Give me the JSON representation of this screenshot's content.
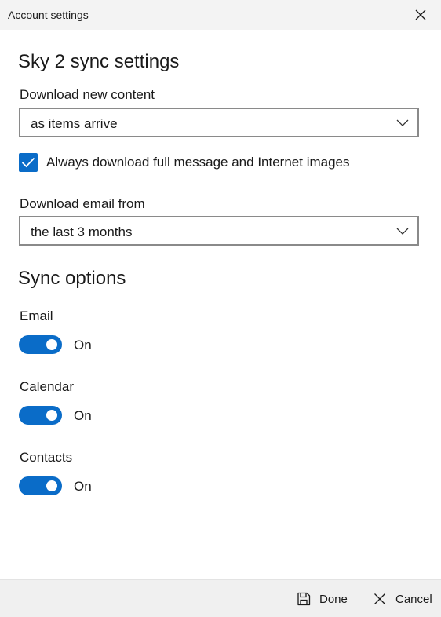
{
  "window": {
    "title": "Account settings",
    "close_icon": "close-icon"
  },
  "sync_settings": {
    "heading": "Sky 2 sync settings",
    "download_new_content": {
      "label": "Download new content",
      "value": "as items arrive"
    },
    "full_message_checkbox": {
      "label": "Always download full message and Internet images",
      "checked": true
    },
    "download_email_from": {
      "label": "Download email from",
      "value": "the last 3 months"
    }
  },
  "sync_options": {
    "heading": "Sync options",
    "items": [
      {
        "label": "Email",
        "state": "On",
        "on": true
      },
      {
        "label": "Calendar",
        "state": "On",
        "on": true
      },
      {
        "label": "Contacts",
        "state": "On",
        "on": true
      }
    ]
  },
  "footer": {
    "done_label": "Done",
    "done_icon": "save-icon",
    "cancel_label": "Cancel",
    "cancel_icon": "close-icon"
  },
  "colors": {
    "accent": "#0a6cc8",
    "titlebar_bg": "#f3f3f3",
    "footer_bg": "#f0f0f0",
    "field_border": "#8a8a8a"
  }
}
